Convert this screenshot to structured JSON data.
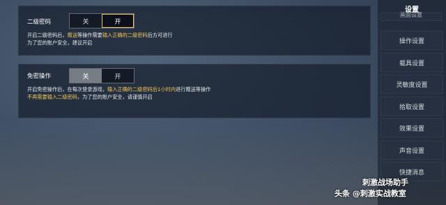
{
  "panels": {
    "secondary_password": {
      "label": "二级密码",
      "toggle": {
        "off": "关",
        "on": "开",
        "selected": "on"
      },
      "desc_line1_a": "开启二级密码后，",
      "desc_line1_b": "赠送",
      "desc_line1_c": "等操作需要",
      "desc_line1_d": "输入正确的二级密码",
      "desc_line1_e": "后方可进行",
      "desc_line2": "为了您的账户安全，建议开启"
    },
    "skip_verification": {
      "label": "免密操作",
      "toggle": {
        "off": "关",
        "on": "开",
        "selected": "off"
      },
      "desc_line1_a": "开启免密操作后，在每次登录游戏，",
      "desc_line1_b": "输入正确的二级密码后1小时内",
      "desc_line1_c": "进行赠送等操作",
      "desc_line2_a": "不再需要输入二级密码",
      "desc_line2_b": "，为了您的账户安全，请谨慎开启"
    }
  },
  "sidebar": {
    "title": "设置",
    "items": [
      {
        "label": "画面设置",
        "partial": true
      },
      {
        "label": "操作设置"
      },
      {
        "label": "载具设置"
      },
      {
        "label": "灵敏度设置"
      },
      {
        "label": "拾取设置"
      },
      {
        "label": "效果设置"
      },
      {
        "label": "声音设置"
      },
      {
        "label": "快捷消息"
      }
    ]
  },
  "watermark": {
    "line1": "刺激战场助手",
    "line2": "头条 @刺激实战教室"
  },
  "colors": {
    "highlight": "#f2c45a",
    "panel_bg": "#161e2c"
  }
}
